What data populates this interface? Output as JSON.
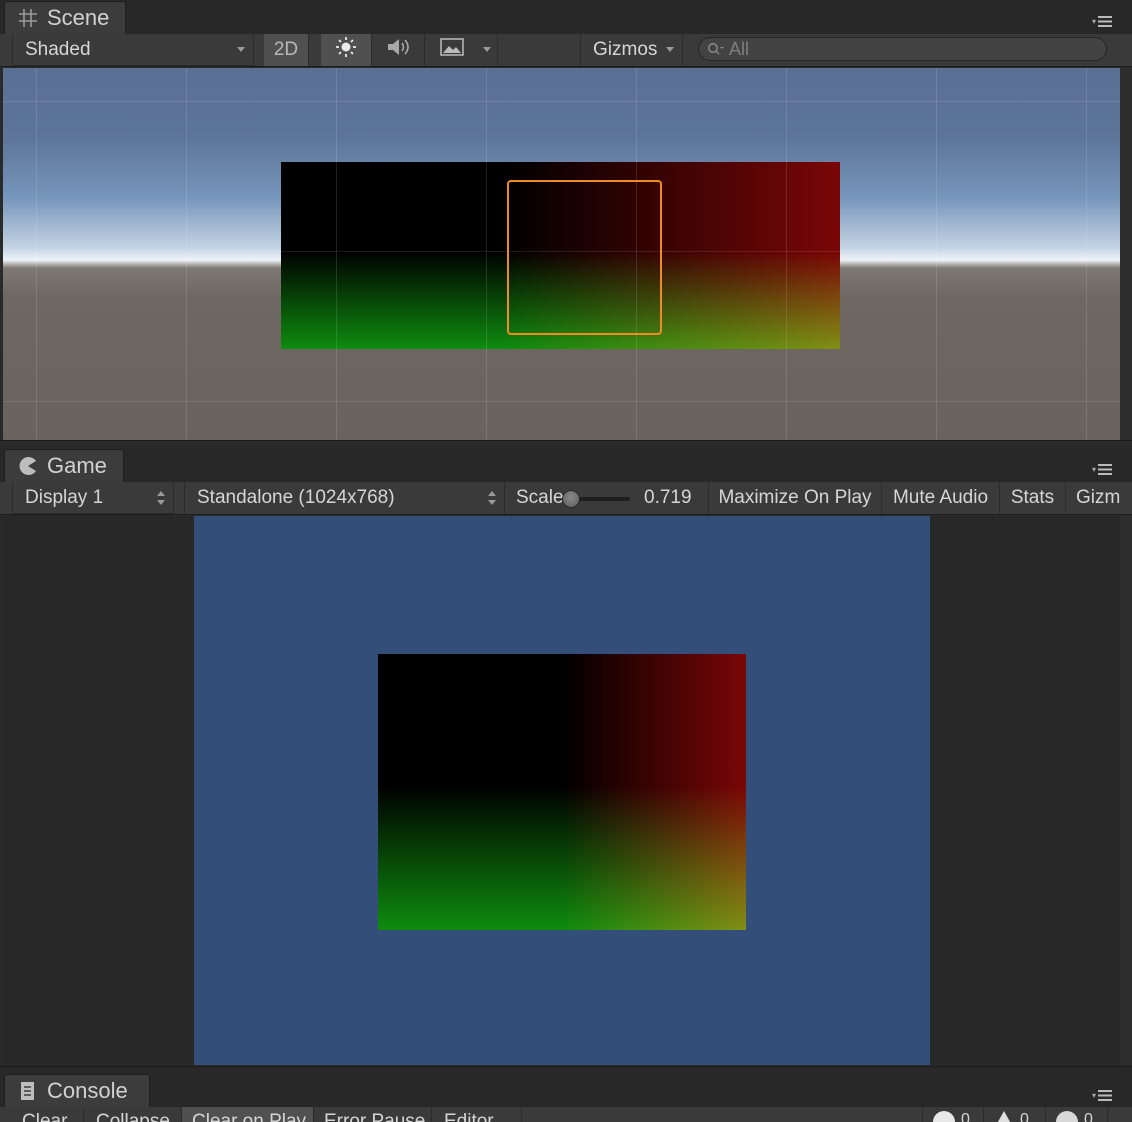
{
  "scene": {
    "tab_label": "Scene",
    "draw_mode": "Shaded",
    "toggle_2d": "2D",
    "gizmos_label": "Gizmos",
    "search_placeholder": "All"
  },
  "game": {
    "tab_label": "Game",
    "display_select": "Display 1",
    "resolution_select": "Standalone (1024x768)",
    "scale_label": "Scale",
    "scale_value": "0.719",
    "maximize_on_play": "Maximize On Play",
    "mute_audio": "Mute Audio",
    "stats": "Stats",
    "gizmos_label": "Gizm"
  },
  "console": {
    "tab_label": "Console",
    "buttons": [
      "Clear",
      "Collapse",
      "Clear on Play",
      "Error Pause",
      "Editor"
    ],
    "counts": [
      "0",
      "0",
      "0"
    ]
  },
  "colors": {
    "selection_outline": "#f08a24",
    "game_background": "#334e78",
    "panel_background": "#2a2a2a"
  }
}
